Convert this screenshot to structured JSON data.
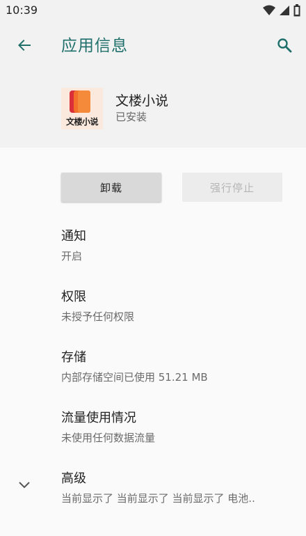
{
  "status_bar": {
    "time": "10:39",
    "icons": [
      "wifi-icon",
      "signal-icon",
      "battery-icon"
    ]
  },
  "header": {
    "title": "应用信息",
    "back_icon": "arrow-left-icon",
    "search_icon": "search-icon",
    "accent_color": "#1f6f6b"
  },
  "app": {
    "name": "文楼小说",
    "status": "已安装",
    "icon_text": "文楼小说"
  },
  "buttons": {
    "uninstall": "卸载",
    "force_stop": "强行停止"
  },
  "settings": [
    {
      "title": "通知",
      "subtitle": "开启"
    },
    {
      "title": "权限",
      "subtitle": "未授予任何权限"
    },
    {
      "title": "存储",
      "subtitle": "内部存储空间已使用 51.21 MB"
    },
    {
      "title": "流量使用情况",
      "subtitle": "未使用任何数据流量"
    },
    {
      "title": "高级",
      "subtitle": "当前显示了 当前显示了 当前显示了 电池.."
    }
  ],
  "advanced_icon": "chevron-down-icon"
}
